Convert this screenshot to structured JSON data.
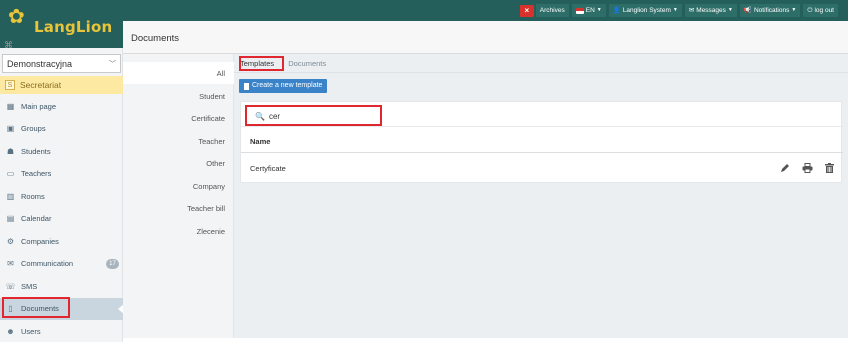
{
  "app": {
    "brand": "LangLion"
  },
  "topnav": {
    "archives": "Archives",
    "language": "EN",
    "user": "Langlion System",
    "messages": "Messages",
    "notifications": "Notifications",
    "logout": "log out"
  },
  "header": {
    "title": "Documents"
  },
  "sidebar": {
    "school": "Demonstracyjna",
    "secretariat_badge": "S",
    "secretariat": "Secretariat",
    "items": [
      {
        "label": "Main page",
        "icon": "dashboard-icon"
      },
      {
        "label": "Groups",
        "icon": "groups-icon"
      },
      {
        "label": "Students",
        "icon": "students-icon"
      },
      {
        "label": "Teachers",
        "icon": "teachers-icon"
      },
      {
        "label": "Rooms",
        "icon": "rooms-icon"
      },
      {
        "label": "Calendar",
        "icon": "calendar-icon"
      },
      {
        "label": "Companies",
        "icon": "companies-icon"
      },
      {
        "label": "Communication",
        "icon": "communication-icon",
        "badge": "17"
      },
      {
        "label": "SMS",
        "icon": "sms-icon"
      },
      {
        "label": "Documents",
        "icon": "documents-icon",
        "active": true
      },
      {
        "label": "Users",
        "icon": "users-icon"
      }
    ]
  },
  "categories": [
    "All",
    "Student",
    "Certificate",
    "Teacher",
    "Other",
    "Company",
    "Teacher bill",
    "Zlecenie"
  ],
  "tabs": {
    "templates": "Templates",
    "documents": "Documents"
  },
  "toolbar": {
    "create": "Create a new template"
  },
  "search": {
    "value": "cer"
  },
  "table": {
    "header": "Name",
    "rows": [
      {
        "name": "Certyficate"
      }
    ]
  },
  "colors": {
    "topbar": "#255f5b",
    "accent": "#3b83c9",
    "highlight": "#e0262f",
    "secretariat": "#fde9a2"
  }
}
